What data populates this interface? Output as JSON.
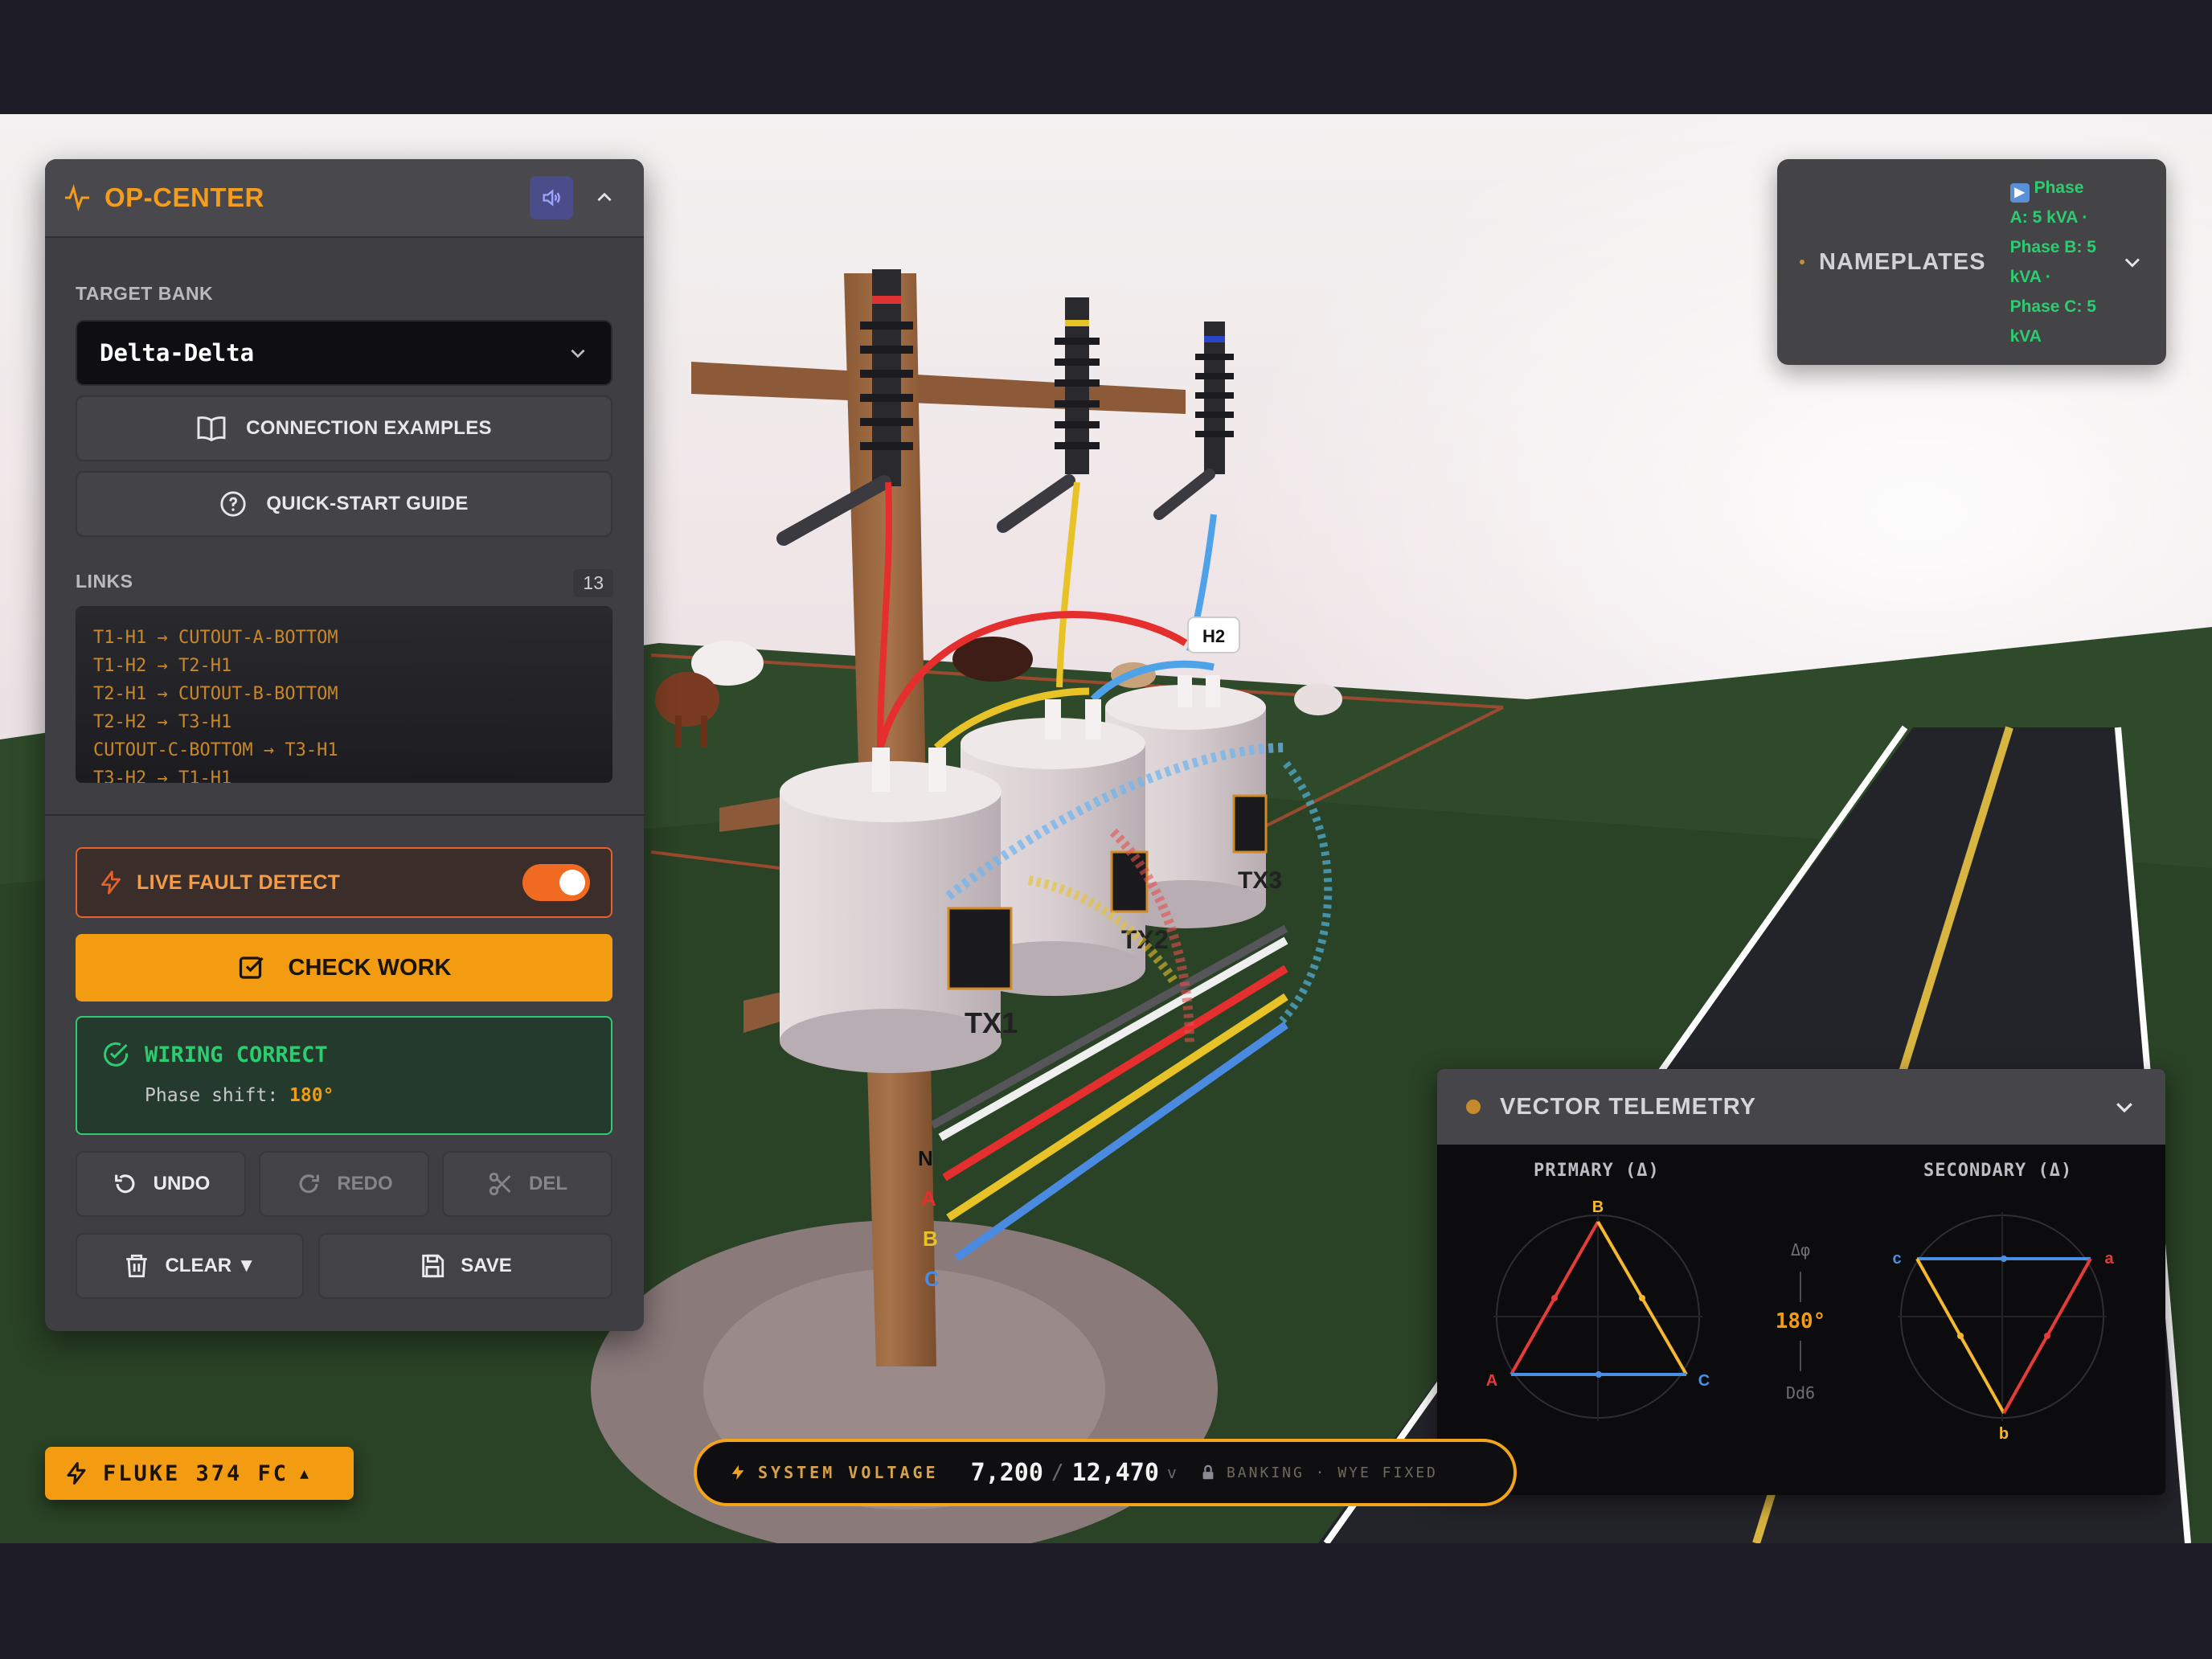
{
  "op_center": {
    "title": "OP-CENTER",
    "target_bank_label": "TARGET BANK",
    "target_bank_value": "Delta-Delta",
    "connection_examples": "CONNECTION EXAMPLES",
    "quick_start": "QUICK-START GUIDE",
    "links_label": "LINKS",
    "links_count": "13",
    "links": [
      "T1-H1 → CUTOUT-A-BOTTOM",
      "T1-H2 → T2-H1",
      "T2-H1 → CUTOUT-B-BOTTOM",
      "T2-H2 → T3-H1",
      "CUTOUT-C-BOTTOM → T3-H1",
      "T3-H2 → T1-H1"
    ],
    "live_fault_detect": "LIVE FAULT DETECT",
    "live_fault_detect_on": true,
    "check_work": "CHECK WORK",
    "status_title": "WIRING CORRECT",
    "status_phase_label": "Phase shift:",
    "status_phase_value": "180°",
    "undo": "UNDO",
    "redo": "REDO",
    "del": "DEL",
    "clear": "CLEAR ▼",
    "save": "SAVE"
  },
  "nameplates": {
    "title": "NAMEPLATES",
    "lines": [
      "Phase",
      "A: 5 kVA ·",
      "Phase B: 5",
      "kVA ·",
      "Phase C: 5",
      "kVA"
    ]
  },
  "scene": {
    "tag_h2": "H2",
    "tx_labels": [
      "TX1",
      "TX2",
      "TX3"
    ],
    "bus_labels": [
      "N",
      "A",
      "B",
      "C"
    ]
  },
  "telemetry": {
    "title": "VECTOR TELEMETRY",
    "primary_label": "PRIMARY (Δ)",
    "secondary_label": "SECONDARY (Δ)",
    "delta_phi": "Δφ",
    "shift_value": "180°",
    "vector_group": "Dd6",
    "primary_vertices": [
      "B",
      "A",
      "C"
    ],
    "secondary_vertices": [
      "c",
      "a",
      "b"
    ],
    "colors": {
      "phase_a": "#e63b3b",
      "phase_b": "#f5b82e",
      "phase_c": "#4a90e2"
    }
  },
  "fluke": {
    "label": "FLUKE 374 FC",
    "arrow": "▲"
  },
  "voltage": {
    "label": "SYSTEM VOLTAGE",
    "primary": "7,200",
    "separator": "/",
    "secondary": "12,470",
    "unit": "v",
    "banking": "BANKING · WYE FIXED"
  }
}
